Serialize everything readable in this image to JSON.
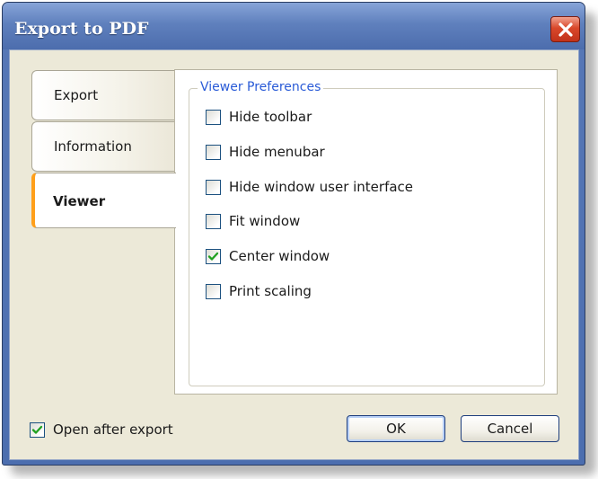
{
  "window": {
    "title": "Export to PDF",
    "close_icon": "close-icon"
  },
  "tabs": [
    {
      "label": "Export",
      "active": false
    },
    {
      "label": "Information",
      "active": false
    },
    {
      "label": "Viewer",
      "active": true
    }
  ],
  "viewer_preferences": {
    "group_title": "Viewer Preferences",
    "options": [
      {
        "label": "Hide toolbar",
        "checked": false
      },
      {
        "label": "Hide menubar",
        "checked": false
      },
      {
        "label": "Hide window user interface",
        "checked": false
      },
      {
        "label": "Fit window",
        "checked": false
      },
      {
        "label": "Center window",
        "checked": true
      },
      {
        "label": "Print scaling",
        "checked": false
      }
    ]
  },
  "footer": {
    "open_after_export_label": "Open after export",
    "open_after_export_checked": true,
    "ok_label": "OK",
    "cancel_label": "Cancel"
  },
  "colors": {
    "accent_tab": "#ff9f1a",
    "group_title": "#2a5bd7",
    "checkmark": "#21a121",
    "close_button": "#d9482b"
  }
}
